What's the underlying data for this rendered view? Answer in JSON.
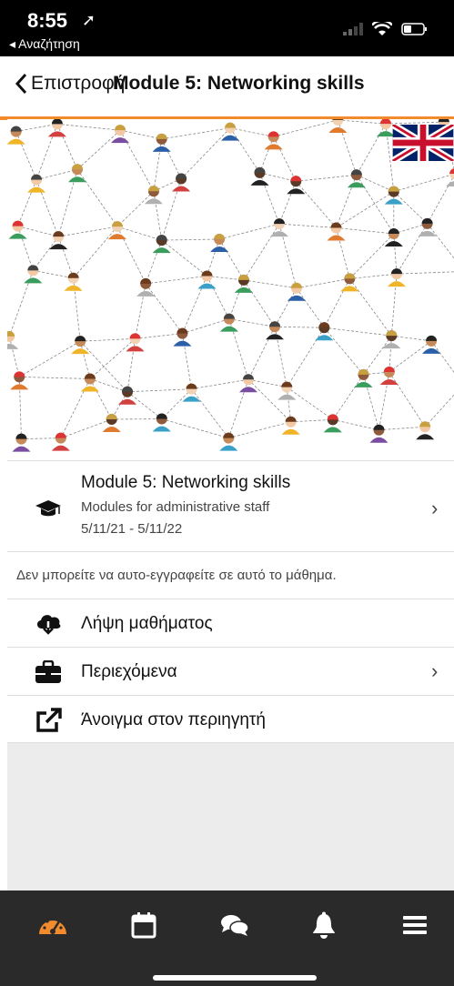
{
  "status_bar": {
    "time": "8:55",
    "back_app": "◂ Αναζήτηση"
  },
  "nav": {
    "back_label": "Επιστροφή",
    "title": "Module 5: Networking skills"
  },
  "hero": {
    "image_desc": "network-of-people-image",
    "flag_icon": "uk-flag-icon"
  },
  "course": {
    "title": "Module 5: Networking skills",
    "category": "Modules for administrative staff",
    "dates": "5/11/21 - 5/11/22"
  },
  "notice": "Δεν μπορείτε να αυτο-εγγραφείτε σε αυτό το μάθημα.",
  "actions": [
    {
      "label": "Λήψη μαθήματος",
      "icon": "cloud-download-icon"
    },
    {
      "label": "Περιεχόμενα",
      "icon": "briefcase-icon"
    },
    {
      "label": "Άνοιγμα στον περιηγητή",
      "icon": "external-link-icon"
    }
  ],
  "tabs": [
    {
      "name": "dashboard",
      "icon": "dashboard-icon",
      "active": true
    },
    {
      "name": "calendar",
      "icon": "calendar-icon"
    },
    {
      "name": "messages",
      "icon": "chat-icon"
    },
    {
      "name": "notifications",
      "icon": "bell-icon"
    },
    {
      "name": "more",
      "icon": "menu-icon"
    }
  ],
  "colors": {
    "accent": "#f28a2e",
    "tabbar": "#2a2a2a",
    "active_tab": "#f28a2e"
  }
}
